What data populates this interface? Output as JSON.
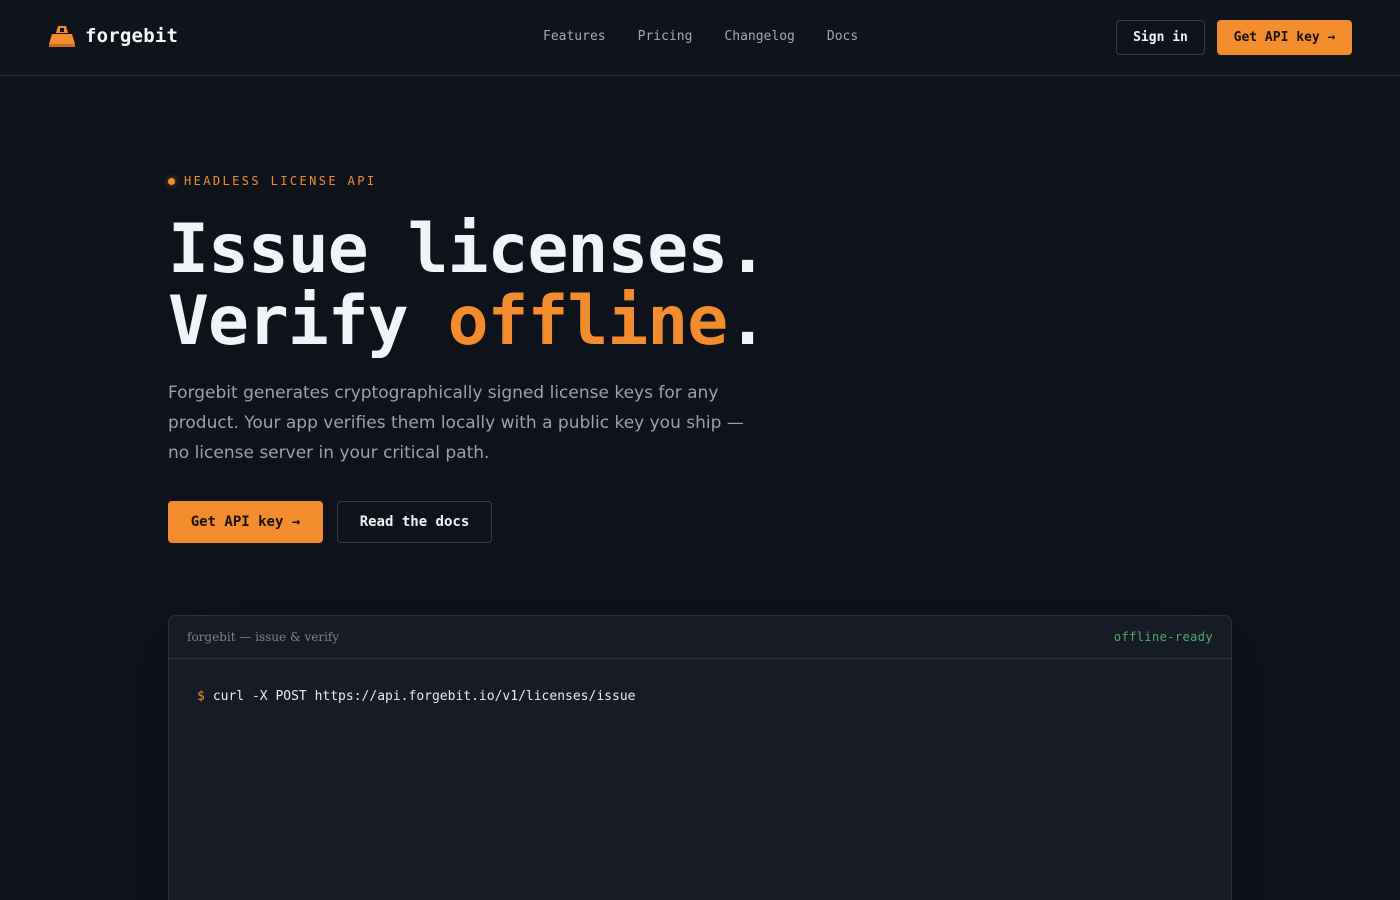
{
  "brand": {
    "name": "forgebit",
    "accent": "#f28c2d",
    "icon": "forge-logo-icon"
  },
  "nav": {
    "items": [
      {
        "label": "Features"
      },
      {
        "label": "Pricing"
      },
      {
        "label": "Changelog"
      },
      {
        "label": "Docs"
      }
    ]
  },
  "header": {
    "sign_in_label": "Sign in",
    "get_key_label": "Get API key →"
  },
  "hero": {
    "eyebrow": "HEADLESS LICENSE API",
    "headline_line1": "Issue licenses.",
    "headline_line2_prefix": "Verify ",
    "headline_line2_accent": "offline",
    "headline_line2_suffix": ".",
    "lead": "Forgebit generates cryptographically signed license keys for any product. Your app verifies them locally with a public key you ship — no license server in your critical path.",
    "primary_cta": "Get API key →",
    "secondary_cta": "Read the docs"
  },
  "terminal": {
    "title": "forgebit — issue & verify",
    "status": "offline-ready",
    "status_color": "#4caf6a",
    "prompt": "$",
    "command": "curl -X POST https://api.forgebit.io/v1/licenses/issue"
  }
}
